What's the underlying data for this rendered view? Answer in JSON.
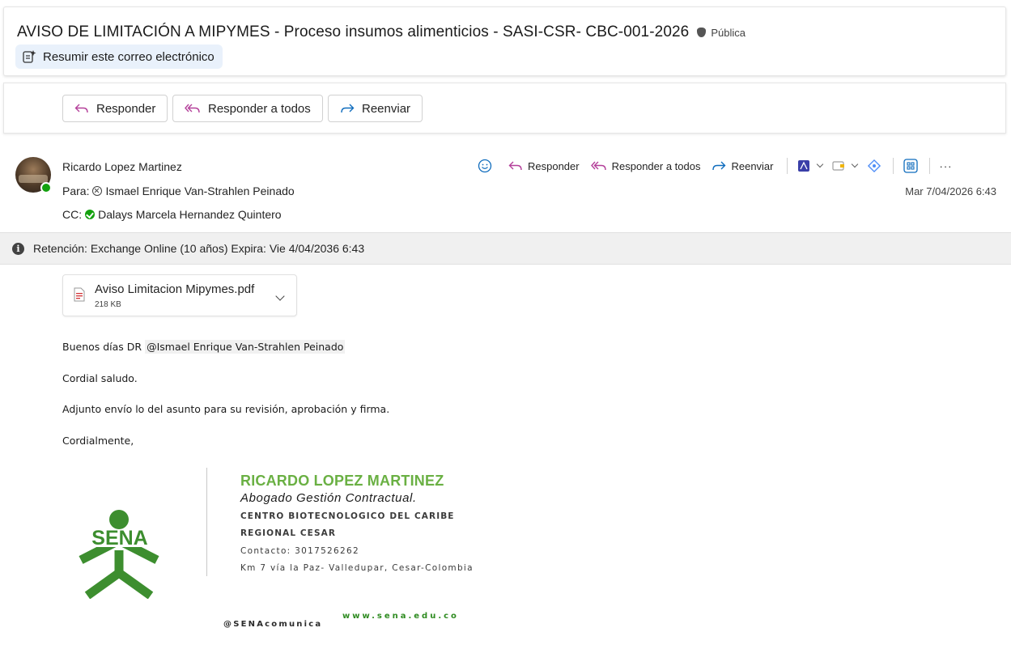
{
  "email": {
    "subject": "AVISO DE LIMITACIÓN A MIPYMES - Proceso insumos alimenticios - SASI-CSR- CBC-001-2026",
    "sensitivity_label": "Pública",
    "summarize_label": "Resumir este correo electrónico"
  },
  "toolbar": {
    "reply_label": "Responder",
    "reply_all_label": "Responder a todos",
    "forward_label": "Reenviar"
  },
  "message": {
    "sender": "Ricardo Lopez Martinez",
    "to_label": "Para:",
    "to_name": "Ismael Enrique Van-Strahlen Peinado",
    "cc_label": "CC:",
    "cc_name": "Dalays Marcela Hernandez Quintero",
    "date": "Mar 7/04/2026 6:43",
    "actions": {
      "reply_label": "Responder",
      "reply_all_label": "Responder a todos",
      "forward_label": "Reenviar",
      "more_label": "···"
    }
  },
  "retention": {
    "text": "Retención: Exchange Online (10 años) Expira: Vie 4/04/2036 6:43"
  },
  "attachment": {
    "file_name": "Aviso Limitacion Mipymes.pdf",
    "file_size": "218 KB"
  },
  "body": {
    "greeting": "Buenos días DR",
    "mention": "@Ismael Enrique Van-Strahlen Peinado",
    "line2": "Cordial saludo.",
    "line3": "Adjunto envío lo del asunto para su revisión, aprobación y firma.",
    "line4": "Cordialmente,"
  },
  "signature": {
    "logo_text": "SENA",
    "name": "RICARDO LOPEZ MARTINEZ",
    "role": "Abogado Gestión Contractual.",
    "center": "CENTRO BIOTECNOLOGICO DEL CARIBE",
    "regional": "REGIONAL CESAR",
    "contact": "Contacto: 3017526262",
    "address": "Km 7 vía la Paz- Valledupar, Cesar-Colombia",
    "handle": "@SENAcomunica",
    "website": "www.sena.edu.co"
  },
  "colors": {
    "sena_green": "#6ab043",
    "reply_pink": "#b4409a",
    "forward_blue": "#0f6cbd",
    "presence_green": "#13a10e"
  }
}
